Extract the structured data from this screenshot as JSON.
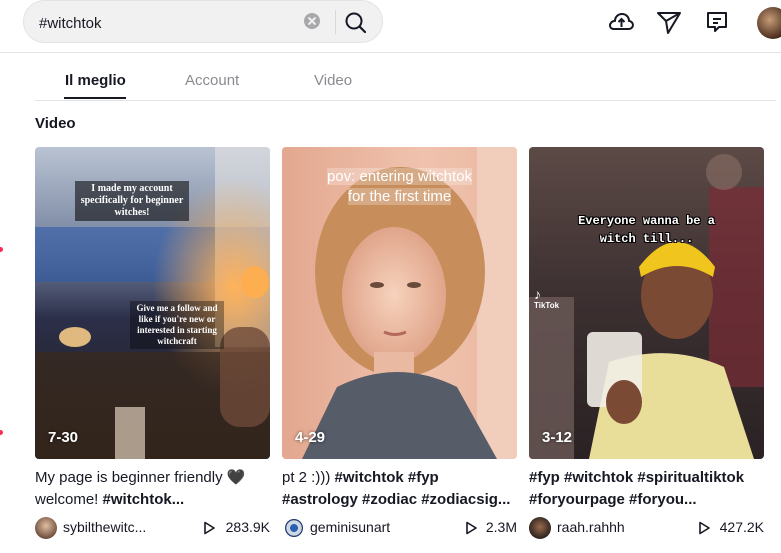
{
  "search": {
    "value": "#witchtok"
  },
  "tabs": [
    {
      "label": "Il meglio",
      "active": true
    },
    {
      "label": "Account",
      "active": false
    },
    {
      "label": "Video",
      "active": false
    }
  ],
  "section_title": "Video",
  "header_icons": [
    "upload-icon",
    "send-icon",
    "inbox-icon"
  ],
  "videos": [
    {
      "date": "7-30",
      "overlay_top": "I made my account specifically for beginner witches!",
      "overlay_bottom": "Give me a follow and like if you're new or interested in starting witchcraft",
      "desc_line1": "My page is beginner friendly 🖤",
      "desc_line2_plain": "welcome! ",
      "desc_line2_tags": "#witchtok...",
      "username": "sybilthewitc...",
      "views": "283.9K"
    },
    {
      "date": "4-29",
      "overlay_line1": "pov: entering witchtok",
      "overlay_line2": "for the first time",
      "desc_line1_plain": "pt 2 :))) ",
      "desc_line1_tags": "#witchtok #fyp",
      "desc_line2_tags": "#astrology #zodiac #zodiacsig...",
      "username": "geminisunart",
      "views": "2.3M"
    },
    {
      "date": "3-12",
      "overlay_line1": "Everyone wanna be a",
      "overlay_line2": "witch till...",
      "watermark": "TikTok",
      "desc_line1_tags": "#fyp #witchtok #spiritualtiktok",
      "desc_line2_tags": "#foryourpage #foryou...",
      "username": "raah.rahhh",
      "views": "427.2K"
    }
  ]
}
